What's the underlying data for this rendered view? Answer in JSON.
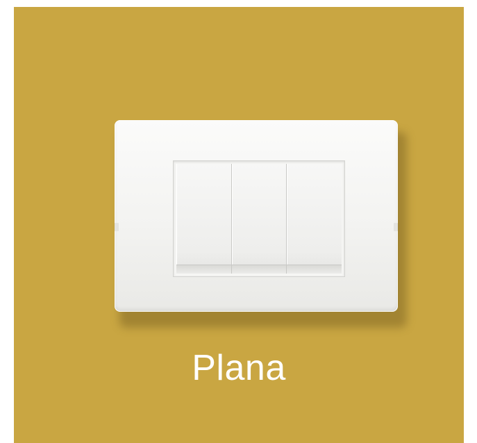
{
  "product": {
    "name": "Plana",
    "background_color": "#c9a642",
    "plate_color": "#f3f3f1",
    "switch_count": 3,
    "switches": [
      {
        "id": "left"
      },
      {
        "id": "middle"
      },
      {
        "id": "right"
      }
    ]
  }
}
